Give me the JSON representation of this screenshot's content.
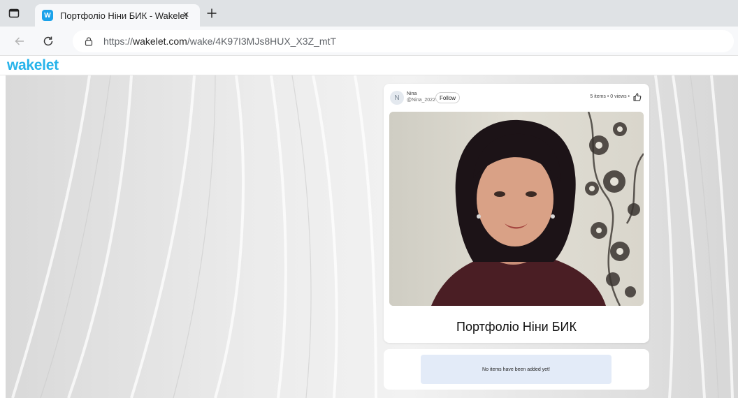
{
  "browser": {
    "tab": {
      "title": "Портфоліо Ніни БИК - Wakelet",
      "favicon_letter": "W",
      "close_glyph": "×"
    },
    "url": {
      "scheme": "https://",
      "host": "wakelet.com",
      "path": "/wake/4K97I3MJs8HUX_X3Z_mtT"
    },
    "icons": [
      "sidebar-icon",
      "close-icon",
      "plus-icon",
      "back-arrow-icon",
      "reload-icon",
      "lock-icon"
    ]
  },
  "site": {
    "logo": "wakelet",
    "brand_color": "#27b3ea"
  },
  "collection": {
    "author": {
      "initial": "N",
      "name": "Nina",
      "handle": "@Nina_2022"
    },
    "follow_label": "Follow",
    "stats": "5 items • 0 views •",
    "title": "Портфоліо Ніни БИК",
    "empty_message": "No items have been added yet!",
    "empty_box_color": "#e3ebf8"
  }
}
